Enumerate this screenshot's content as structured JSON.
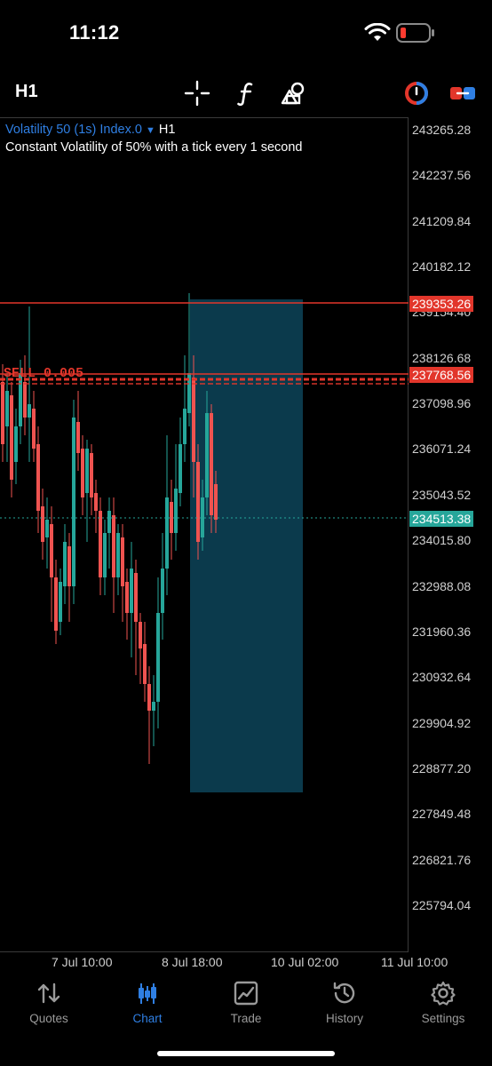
{
  "status_bar": {
    "time": "11:12"
  },
  "toolbar": {
    "timeframe": "H1",
    "tools": [
      "crosshair-icon",
      "indicators-icon",
      "objects-icon"
    ],
    "right_icons": [
      "one-click-trading-icon",
      "chart-type-icon"
    ]
  },
  "chart": {
    "symbol": "Volatility 50 (1s) Index.0",
    "caret": "▼",
    "period": "H1",
    "description": "Constant Volatility of 50% with a tick every 1 second",
    "price_ticks": [
      "243265.28",
      "242237.56",
      "241209.84",
      "240182.12",
      "239154.40",
      "238126.68",
      "237098.96",
      "236071.24",
      "235043.52",
      "234015.80",
      "232988.08",
      "231960.36",
      "230932.64",
      "229904.92",
      "228877.20",
      "227849.48",
      "226821.76",
      "225794.04"
    ],
    "time_ticks": [
      "7 Jul 10:00",
      "8 Jul 18:00",
      "10 Jul 02:00",
      "11 Jul 10:00"
    ],
    "level_line_price": "239353.26",
    "order_line_price": "237768.56",
    "order_label": "SELL 0.005",
    "current_bid": "234513.38",
    "colors": {
      "bull": "#26a69a",
      "bear": "#ef5350",
      "level": "#e2362b",
      "bid": "#26a69a",
      "box": "#0b3a4c",
      "accent": "#2f7fe3"
    }
  },
  "tabs": [
    {
      "label": "Quotes",
      "icon": "quotes-icon",
      "active": false
    },
    {
      "label": "Chart",
      "icon": "chart-icon",
      "active": true
    },
    {
      "label": "Trade",
      "icon": "trade-icon",
      "active": false
    },
    {
      "label": "History",
      "icon": "history-icon",
      "active": false
    },
    {
      "label": "Settings",
      "icon": "gear-icon",
      "active": false
    }
  ]
}
